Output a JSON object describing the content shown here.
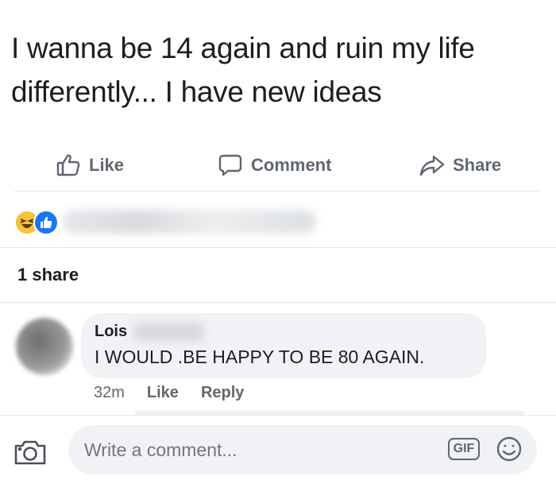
{
  "post": {
    "text_line1": "I wanna be 14 again and ruin my life",
    "text_line2": "differently... I have new ideas"
  },
  "actions": {
    "like_label": "Like",
    "comment_label": "Comment",
    "share_label": "Share"
  },
  "reactions": {
    "icons": [
      "haha-icon",
      "like-icon"
    ]
  },
  "shares": {
    "count_label": "1 share"
  },
  "comment": {
    "author": "Lois",
    "text": "I WOULD .BE HAPPY TO BE 80 AGAIN.",
    "time": "32m",
    "like_label": "Like",
    "reply_label": "Reply"
  },
  "composer": {
    "placeholder": "Write a comment...",
    "gif_label": "GIF"
  },
  "colors": {
    "text": "#1c1e21",
    "muted": "#606770",
    "bubble": "#f0f2f5",
    "like_blue": "#1877f2",
    "haha_yellow": "#f7c235"
  }
}
